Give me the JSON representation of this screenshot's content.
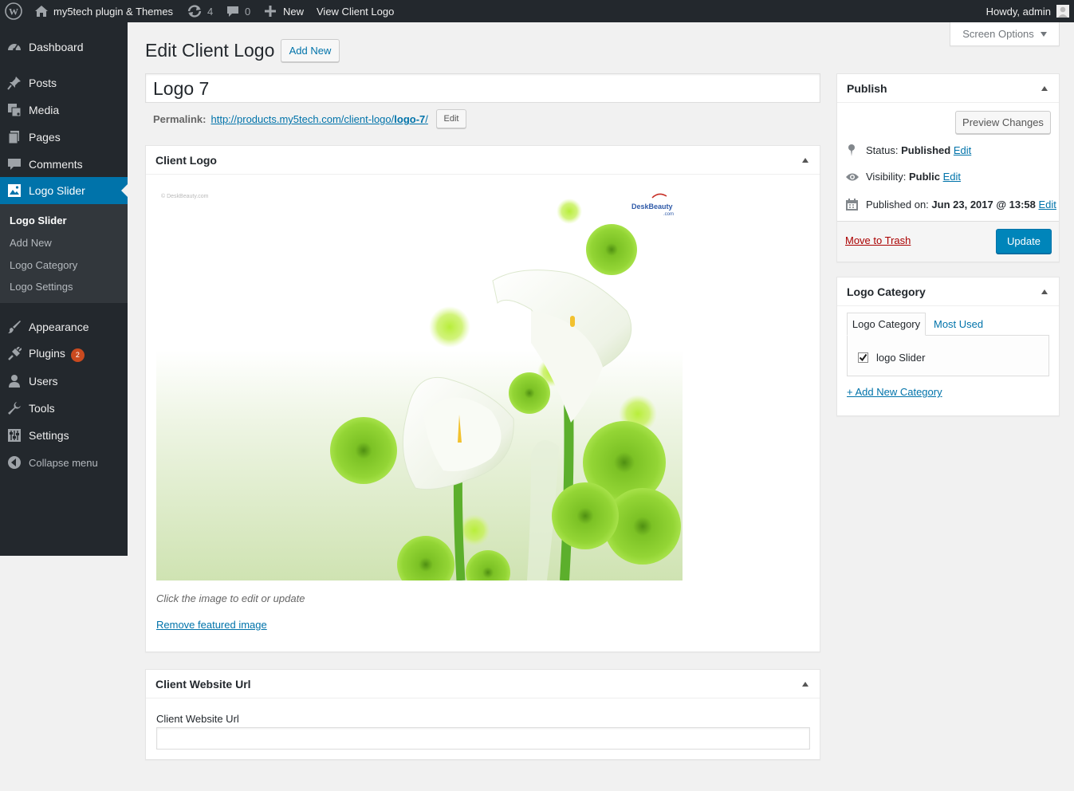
{
  "adminbar": {
    "site_name": "my5tech plugin & Themes",
    "updates_count": "4",
    "comments_count": "0",
    "new_label": "New",
    "view_label": "View Client Logo",
    "greeting": "Howdy, admin"
  },
  "sidebar": {
    "dashboard": "Dashboard",
    "posts": "Posts",
    "media": "Media",
    "pages": "Pages",
    "comments": "Comments",
    "logo_slider": "Logo Slider",
    "submenu": [
      "Logo Slider",
      "Add New",
      "Logo Category",
      "Logo Settings"
    ],
    "appearance": "Appearance",
    "plugins": "Plugins",
    "plugins_badge": "2",
    "users": "Users",
    "tools": "Tools",
    "settings": "Settings",
    "collapse": "Collapse menu"
  },
  "screen_options": "Screen Options",
  "page": {
    "title": "Edit Client Logo",
    "add_new": "Add New",
    "post_title": "Logo 7",
    "permalink_label": "Permalink:",
    "permalink_base": "http://products.my5tech.com/client-logo/",
    "permalink_slug": "logo-7",
    "permalink_end": "/",
    "permalink_edit": "Edit"
  },
  "client_logo_box": {
    "title": "Client Logo",
    "watermark": "© DeskBeauty.com",
    "brand_logo": "DeskBeauty",
    "brand_logo_sub": ".com",
    "hint": "Click the image to edit or update",
    "remove_link": "Remove featured image"
  },
  "url_box": {
    "title": "Client Website Url",
    "field_label": "Client Website Url",
    "field_value": ""
  },
  "publish": {
    "title": "Publish",
    "preview": "Preview Changes",
    "status_label": "Status:",
    "status_value": "Published",
    "visibility_label": "Visibility:",
    "visibility_value": "Public",
    "published_label": "Published on:",
    "published_value": "Jun 23, 2017 @ 13:58",
    "edit": "Edit",
    "trash": "Move to Trash",
    "update": "Update"
  },
  "category": {
    "title": "Logo Category",
    "tab_all": "Logo Category",
    "tab_used": "Most Used",
    "item": "logo Slider",
    "item_checked": true,
    "add_new": "+ Add New Category"
  }
}
